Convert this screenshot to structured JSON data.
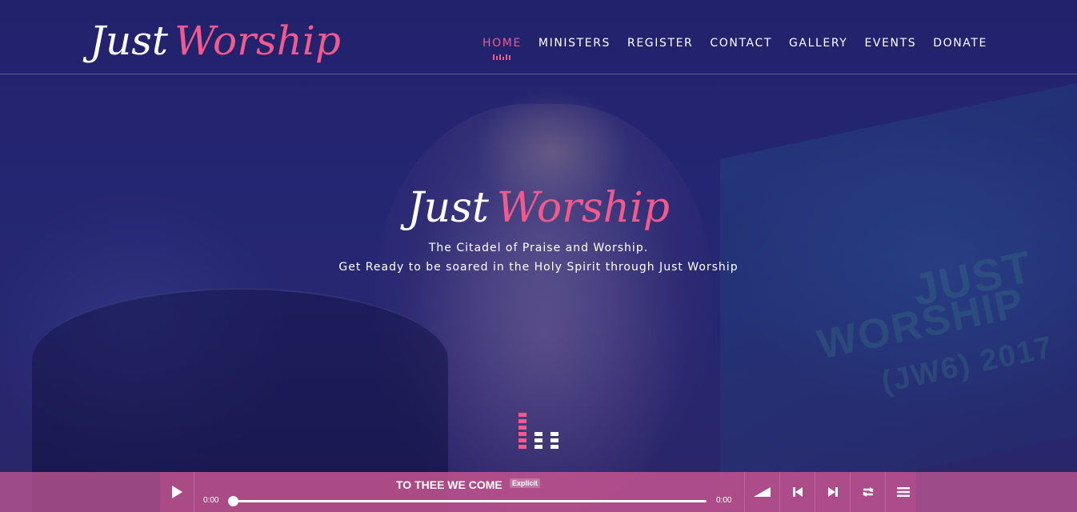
{
  "brand": {
    "logo_word1": "Just",
    "logo_word2": "Worship",
    "accent_color": "#f05a8c"
  },
  "nav": {
    "items": [
      {
        "label": "HOME",
        "active": true
      },
      {
        "label": "MINISTERS",
        "active": false
      },
      {
        "label": "REGISTER",
        "active": false
      },
      {
        "label": "CONTACT",
        "active": false
      },
      {
        "label": "GALLERY",
        "active": false
      },
      {
        "label": "EVENTS",
        "active": false
      },
      {
        "label": "DONATE",
        "active": false
      }
    ]
  },
  "hero": {
    "logo_word1": "Just",
    "logo_word2": "Worship",
    "tagline1": "The Citadel of Praise and Worship.",
    "tagline2": "Get Ready to be soared in the Holy Spirit through Just Worship"
  },
  "background_text": {
    "line1": "JUST",
    "line2": "WORSHIP",
    "line3": "(JW6) 2017"
  },
  "player": {
    "track_title": "TO THEE WE COME",
    "explicit_label": "Explicit",
    "current_time": "0:00",
    "duration": "0:00",
    "progress": 0,
    "icons": {
      "play": "play-icon",
      "volume": "volume-icon",
      "previous": "previous-icon",
      "next": "next-icon",
      "repeat": "repeat-icon",
      "playlist": "playlist-icon"
    }
  }
}
